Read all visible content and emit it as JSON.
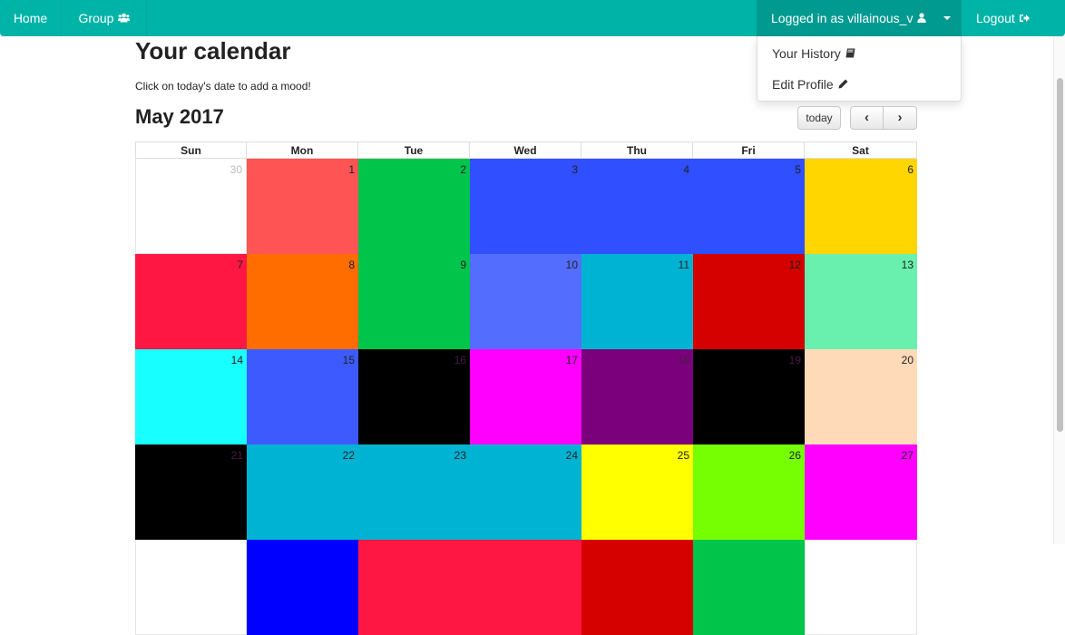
{
  "nav": {
    "home": "Home",
    "group": "Group",
    "group_icon": "users-icon",
    "user": "Logged in as villainous_v",
    "user_icon": "user-icon",
    "logout": "Logout",
    "logout_icon": "sign-out-icon"
  },
  "dropdown": {
    "history": "Your History",
    "history_icon": "book-icon",
    "profile": "Edit Profile",
    "profile_icon": "pencil-icon"
  },
  "page": {
    "title": "Your calendar",
    "instructions": "Click on today's date to add a mood!"
  },
  "calendar": {
    "month": "May 2017",
    "today_label": "today",
    "prev_symbol": "‹",
    "next_symbol": "›",
    "weekdays": [
      "Sun",
      "Mon",
      "Tue",
      "Wed",
      "Thu",
      "Fri",
      "Sat"
    ],
    "weeks": [
      [
        {
          "day": "30",
          "color": "#ffffff",
          "muted": true
        },
        {
          "day": "1",
          "color": "#ff5454"
        },
        {
          "day": "2",
          "color": "#00c54b"
        },
        {
          "day": "3",
          "color": "#304ffe"
        },
        {
          "day": "4",
          "color": "#304ffe"
        },
        {
          "day": "5",
          "color": "#304ffe"
        },
        {
          "day": "6",
          "color": "#ffd600"
        }
      ],
      [
        {
          "day": "7",
          "color": "#ff1744"
        },
        {
          "day": "8",
          "color": "#ff6d00"
        },
        {
          "day": "9",
          "color": "#00c54b"
        },
        {
          "day": "10",
          "color": "#536dfe"
        },
        {
          "day": "11",
          "color": "#00b3d3"
        },
        {
          "day": "12",
          "color": "#d50000"
        },
        {
          "day": "13",
          "color": "#69f0ae"
        }
      ],
      [
        {
          "day": "14",
          "color": "#18ffff"
        },
        {
          "day": "15",
          "color": "#3d5afe"
        },
        {
          "day": "16",
          "color": "#000000"
        },
        {
          "day": "17",
          "color": "#ff00ff"
        },
        {
          "day": "18",
          "color": "#7b007b"
        },
        {
          "day": "19",
          "color": "#000000"
        },
        {
          "day": "20",
          "color": "#ffdab9"
        }
      ],
      [
        {
          "day": "21",
          "color": "#000000"
        },
        {
          "day": "22",
          "color": "#00b3d3"
        },
        {
          "day": "23",
          "color": "#00b3d3"
        },
        {
          "day": "24",
          "color": "#00b3d3"
        },
        {
          "day": "25",
          "color": "#ffff00"
        },
        {
          "day": "26",
          "color": "#76ff03"
        },
        {
          "day": "27",
          "color": "#ff00ff"
        }
      ],
      [
        {
          "day": "",
          "color": "#ffffff"
        },
        {
          "day": "",
          "color": "#0000ff"
        },
        {
          "day": "",
          "color": "#ff1744"
        },
        {
          "day": "",
          "color": "#ff1744"
        },
        {
          "day": "",
          "color": "#d50000"
        },
        {
          "day": "",
          "color": "#00c54b"
        },
        {
          "day": "",
          "color": "#ffffff"
        }
      ]
    ]
  }
}
